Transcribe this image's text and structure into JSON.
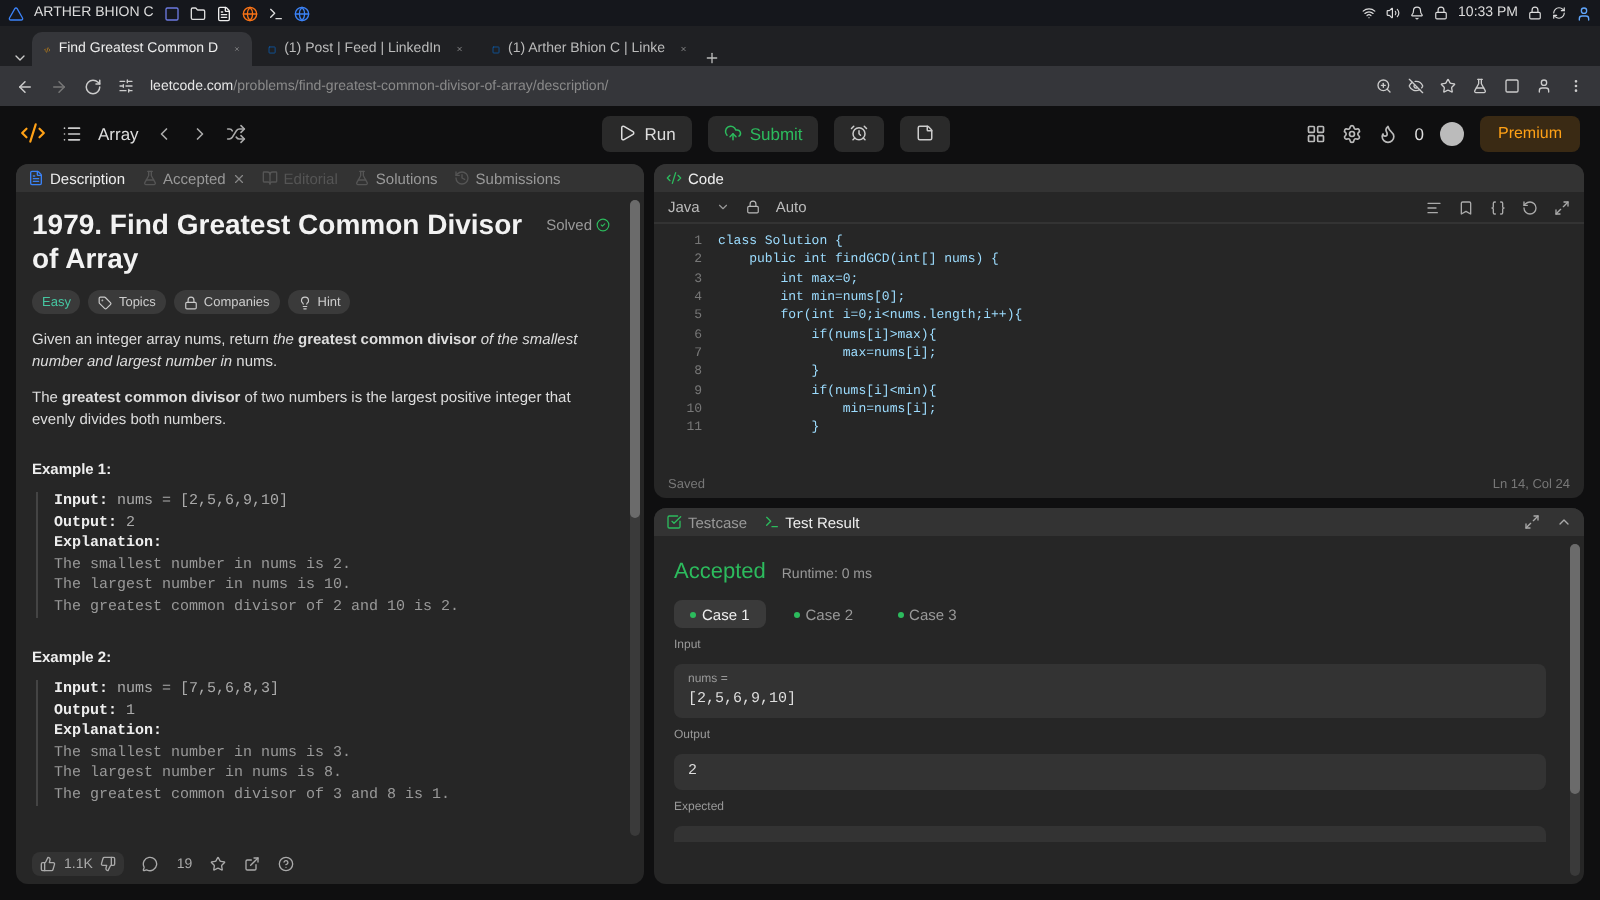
{
  "os_bar": {
    "user": "ARTHER BHION C",
    "time": "10:33 PM"
  },
  "browser_tabs": [
    {
      "title": "Find Greatest Common D",
      "selected": true
    },
    {
      "title": "(1) Post | Feed | LinkedIn",
      "selected": false
    },
    {
      "title": "(1) Arther Bhion C | Linke",
      "selected": false
    }
  ],
  "address_bar": {
    "domain": "leetcode.com",
    "path": "/problems/find-greatest-common-divisor-of-array/description/"
  },
  "header": {
    "breadcrumb": "Array",
    "run": "Run",
    "submit": "Submit",
    "streak": "0",
    "premium": "Premium"
  },
  "left_panel": {
    "tabs": [
      {
        "label": "Description",
        "selected": true,
        "disabled": false
      },
      {
        "label": "Accepted",
        "selected": false,
        "disabled": false
      },
      {
        "label": "Editorial",
        "selected": false,
        "disabled": true
      },
      {
        "label": "Solutions",
        "selected": false,
        "disabled": false
      },
      {
        "label": "Submissions",
        "selected": false,
        "disabled": false
      }
    ],
    "title": "1979. Find Greatest Common Divisor of Array",
    "status": "Solved",
    "tags": [
      {
        "label": "Easy",
        "kind": "difficulty"
      },
      {
        "label": "Topics",
        "kind": "topics"
      },
      {
        "label": "Companies",
        "kind": "companies"
      },
      {
        "label": "Hint",
        "kind": "hint"
      }
    ],
    "paragraphs": [
      "Given an integer array nums, return *the* **greatest common divisor** *of the smallest number and largest number in* nums.",
      "The **greatest common divisor** of two numbers is the largest positive integer that evenly divides both numbers."
    ],
    "examples": [
      {
        "heading": "Example 1:",
        "lines": [
          "**Input:** nums = [2,5,6,9,10]",
          "**Output:** 2",
          "**Explanation:**",
          "The smallest number in nums is 2.",
          "The largest number in nums is 10.",
          "The greatest common divisor of 2 and 10 is 2."
        ]
      },
      {
        "heading": "Example 2:",
        "lines": [
          "**Input:** nums = [7,5,6,8,3]",
          "**Output:** 1",
          "**Explanation:**",
          "The smallest number in nums is 3.",
          "The largest number in nums is 8.",
          "The greatest common divisor of 3 and 8 is 1."
        ]
      }
    ],
    "footer": {
      "likes": "1.1K",
      "comments": "19"
    }
  },
  "code_panel": {
    "title": "Code",
    "language": "Java",
    "mode": "Auto",
    "lines": [
      {
        "number": "1",
        "text": "class Solution {"
      },
      {
        "number": "2",
        "text": "    public int findGCD(int[] nums) {"
      },
      {
        "number": "3",
        "text": "        int max=0;"
      },
      {
        "number": "4",
        "text": "        int min=nums[0];"
      },
      {
        "number": "5",
        "text": "        for(int i=0;i<nums.length;i++){"
      },
      {
        "number": "6",
        "text": "            if(nums[i]>max){"
      },
      {
        "number": "7",
        "text": "                max=nums[i];"
      },
      {
        "number": "8",
        "text": "            }"
      },
      {
        "number": "9",
        "text": "            if(nums[i]<min){"
      },
      {
        "number": "10",
        "text": "                min=nums[i];"
      },
      {
        "number": "11",
        "text": "            }"
      }
    ],
    "status": "Saved",
    "cursor": "Ln 14, Col 24"
  },
  "result_panel": {
    "tabs": [
      {
        "label": "Testcase",
        "selected": false
      },
      {
        "label": "Test Result",
        "selected": true
      }
    ],
    "verdict": "Accepted",
    "runtime": "Runtime: 0 ms",
    "cases": [
      {
        "label": "Case 1",
        "selected": true
      },
      {
        "label": "Case 2",
        "selected": false
      },
      {
        "label": "Case 3",
        "selected": false
      }
    ],
    "input_label": "Input",
    "input_name": "nums =",
    "input_value": "[2,5,6,9,10]",
    "output_label": "Output",
    "output_value": "2",
    "expected_label": "Expected"
  }
}
